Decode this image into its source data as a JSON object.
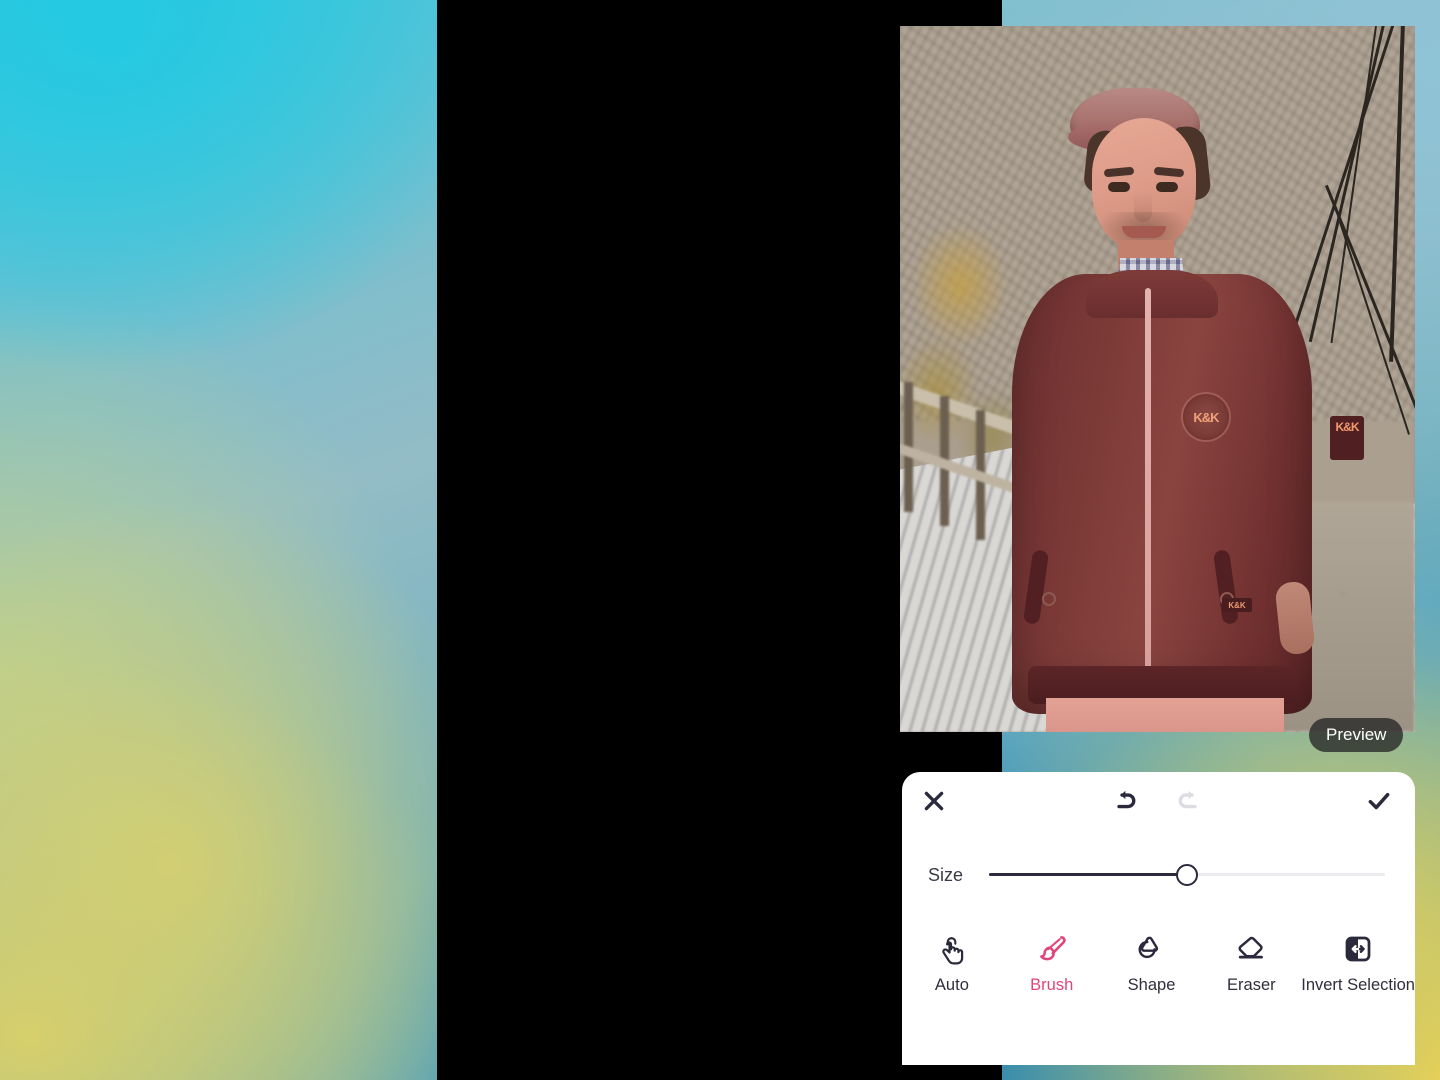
{
  "app": {
    "screen_name": "photo-cutout-selection-editor"
  },
  "canvas": {
    "preview_badge": "Preview",
    "photo_alt": "Man in maroon bomber jacket and wool cap standing on a wooden suspension bridge",
    "photo_logos": {
      "chest_badge": "K&K",
      "sleeve_patch": "K&K",
      "pocket_tab": "K&K"
    }
  },
  "sheet": {
    "toolbar": {
      "close_label": "Close",
      "close_icon": "close-x-icon",
      "undo_label": "Undo",
      "undo_icon": "undo-arrow-icon",
      "undo_enabled": "true",
      "redo_label": "Redo",
      "redo_icon": "redo-arrow-icon",
      "redo_enabled": "false",
      "done_label": "Done",
      "done_icon": "checkmark-icon"
    },
    "size_slider": {
      "label": "Size",
      "value": 50,
      "min": 0,
      "max": 100
    },
    "tools": [
      {
        "id": "auto",
        "label": "Auto",
        "icon": "tap-hand-icon",
        "selected": false
      },
      {
        "id": "brush",
        "label": "Brush",
        "icon": "paintbrush-icon",
        "selected": true
      },
      {
        "id": "shape",
        "label": "Shape",
        "icon": "shapes-icon",
        "selected": false
      },
      {
        "id": "eraser",
        "label": "Eraser",
        "icon": "eraser-icon",
        "selected": false
      },
      {
        "id": "invert",
        "label": "Invert Selection",
        "icon": "invert-selection-icon",
        "selected": false
      }
    ]
  },
  "colors": {
    "accent": "#e0447a",
    "ink": "#2b2a3d",
    "disabled": "#dcdce2",
    "sheet_bg": "#ffffff",
    "device_frame": "#000000",
    "slider_track": "#ececf0"
  }
}
